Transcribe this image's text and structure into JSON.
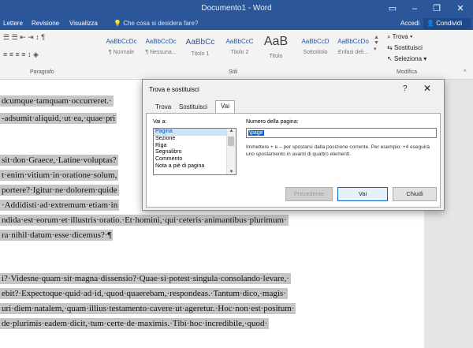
{
  "window": {
    "title": "Documento1 - Word"
  },
  "menu": {
    "tabs": [
      "Lettere",
      "Revisione",
      "Visualizza"
    ],
    "tell_me": "Che cosa si desidera fare?",
    "accedi": "Accedi",
    "share": "Condividi"
  },
  "ribbon": {
    "groups": {
      "paragraph": "Paragrafo",
      "styles": "Stili",
      "edit": "Modifica"
    },
    "styles": [
      {
        "sample": "AaBbCcDc",
        "name": "¶ Normale"
      },
      {
        "sample": "AaBbCcDc",
        "name": "¶ Nessuna..."
      },
      {
        "sample": "AaBbCc",
        "name": "Titolo 1"
      },
      {
        "sample": "AaBbCcC",
        "name": "Titolo 2"
      },
      {
        "sample": "AaB",
        "name": "Titolo"
      },
      {
        "sample": "AaBbCcD",
        "name": "Sottotitolo"
      },
      {
        "sample": "AaBbCcDo",
        "name": "Enfasi deli..."
      }
    ],
    "edit": {
      "find": "Trova",
      "replace": "Sostituisci",
      "select": "Seleziona"
    }
  },
  "document": {
    "lines": [
      "dcumque·tamquam·occurreret.·",
      "-adsumit·aliquid,·ut·ea,·quae·pri",
      "sit·don·Graece,·Latine·voluptas?",
      "t·enim·vitium·in·oratione·solum,",
      "portere?·Igitur·ne·dolorem·quide",
      "·Addidisti·ad·extremum·etiam·in",
      "ndida·est·eorum·et·illustris·oratio.·Et·homini,·qui·ceteris·animantibus·plurimum·",
      "ra·nihil·datum·esse·dicemus?·¶",
      "i?·Videsne·quam·sit·magna·dissensio?·Quae·si·potest·singula·consolando·levare,·",
      "ebit?·Expectoque·quid·ad·id,·quod·quaerebam,·respondeas.·Tantum·dico,·magis·",
      "uri·diem·natalem,·quam·illius·testamento·cavere·ut·ageretur.·Hoc·non·est·positum·",
      "de·plurimis·eadem·dicit,·tum·certe·de·maximis.·Tibi·hoc·incredibile,·quod·"
    ]
  },
  "dialog": {
    "title": "Trova e sostituisci",
    "help": "?",
    "close": "✕",
    "tabs": [
      "Trova",
      "Sostituisci",
      "Vai"
    ],
    "goto_label": "Vai a:",
    "goto_items": [
      "Pagina",
      "Sezione",
      "Riga",
      "Segnalibro",
      "Commento",
      "Nota a piè di pagina"
    ],
    "selected_item": "Pagina",
    "page_number_label": "Numero della pagina:",
    "page_number_value": "\\page",
    "hint": "Immettere + e – per spostarsi dalla posizione corrente. Per esempio: +4 eseguirà uno spostamento in avanti di quattro elementi.",
    "buttons": {
      "previous": "Precedente",
      "goto": "Vai",
      "close": "Chiudi"
    }
  }
}
